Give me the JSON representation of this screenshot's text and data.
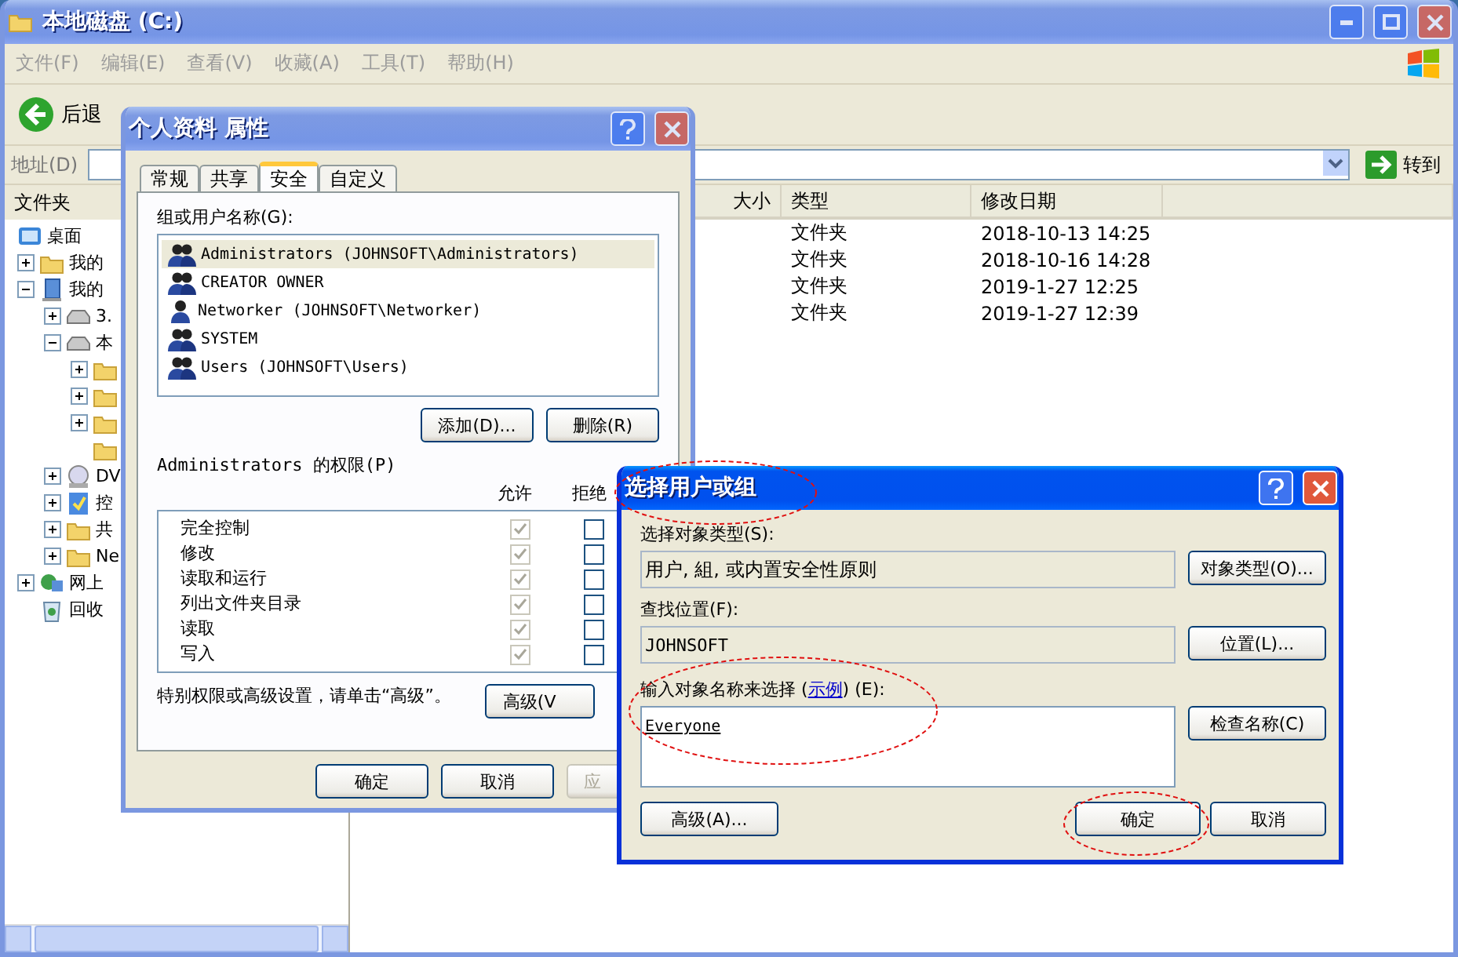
{
  "explorer": {
    "title": "本地磁盘 (C:)",
    "active": false,
    "menu": [
      "文件(F)",
      "编辑(E)",
      "查看(V)",
      "收藏(A)",
      "工具(T)",
      "帮助(H)"
    ],
    "back_label": "后退",
    "address_label": "地址(D)",
    "go_label": "转到",
    "folders_header": "文件夹",
    "tree": [
      {
        "label": "桌面",
        "kind": "desktop",
        "children": [
          {
            "label": "我的",
            "kind": "folder",
            "expanded": false
          },
          {
            "label": "我的",
            "kind": "computer",
            "expanded": true,
            "children": [
              {
                "label": "3.",
                "kind": "drive",
                "expanded": false
              },
              {
                "label": "本",
                "kind": "drive",
                "expanded": true,
                "children": [
                  {
                    "kind": "folder",
                    "expanded": false
                  },
                  {
                    "kind": "folder",
                    "expanded": false
                  },
                  {
                    "kind": "folder",
                    "expanded": false
                  },
                  {
                    "kind": "folder"
                  }
                ]
              },
              {
                "label": "DV",
                "kind": "disc",
                "expanded": false
              },
              {
                "label": "控",
                "kind": "panel",
                "expanded": false
              },
              {
                "label": "共",
                "kind": "folder",
                "expanded": false
              },
              {
                "label": "Ne",
                "kind": "folder",
                "expanded": false
              }
            ]
          },
          {
            "label": "网上",
            "kind": "network",
            "expanded": false
          },
          {
            "label": "回收",
            "kind": "bin"
          }
        ]
      }
    ],
    "columns": [
      "大小",
      "类型",
      "修改日期"
    ],
    "rows": [
      {
        "type": "文件夹",
        "modified": "2018-10-13 14:25"
      },
      {
        "type": "文件夹",
        "modified": "2018-10-16 14:28"
      },
      {
        "type": "文件夹",
        "modified": "2019-1-27 12:25"
      },
      {
        "type": "文件夹",
        "modified": "2019-1-27 12:39"
      }
    ]
  },
  "properties_dialog": {
    "title": "个人资料 属性",
    "active": false,
    "tabs": [
      {
        "label": "常规",
        "selected": false
      },
      {
        "label": "共享",
        "selected": false
      },
      {
        "label": "安全",
        "selected": true
      },
      {
        "label": "自定义",
        "selected": false
      }
    ],
    "users_label": "组或用户名称(G):",
    "users": [
      {
        "name": "Administrators (JOHNSOFT\\Administrators)",
        "kind": "group",
        "selected": true
      },
      {
        "name": "CREATOR OWNER",
        "kind": "group",
        "selected": false
      },
      {
        "name": "Networker (JOHNSOFT\\Networker)",
        "kind": "user",
        "selected": false
      },
      {
        "name": "SYSTEM",
        "kind": "group",
        "selected": false
      },
      {
        "name": "Users (JOHNSOFT\\Users)",
        "kind": "group",
        "selected": false
      }
    ],
    "user_buttons": [
      "添加(D)...",
      "删除(R)"
    ],
    "permissions_label": "Administrators 的权限(P)",
    "allow_header": "允许",
    "deny_header": "拒绝",
    "permissions": [
      {
        "name": "完全控制",
        "allow": true,
        "deny": false,
        "inherited": true
      },
      {
        "name": "修改",
        "allow": true,
        "deny": false,
        "inherited": true
      },
      {
        "name": "读取和运行",
        "allow": true,
        "deny": false,
        "inherited": true
      },
      {
        "name": "列出文件夹目录",
        "allow": true,
        "deny": false,
        "inherited": true
      },
      {
        "name": "读取",
        "allow": true,
        "deny": false,
        "inherited": true
      },
      {
        "name": "写入",
        "allow": true,
        "deny": false,
        "inherited": true
      }
    ],
    "note": "特别权限或高级设置，请单击“高级”。",
    "advanced_button": {
      "label": "高级(V",
      "cut": true
    },
    "buttons": [
      {
        "label": "确定",
        "disabled": false,
        "cut": false
      },
      {
        "label": "取消",
        "disabled": false,
        "cut": false
      },
      {
        "label": "应",
        "disabled": true,
        "cut": true
      }
    ]
  },
  "select_dialog": {
    "title": "选择用户或组",
    "active": true,
    "type_label": "选择对象类型(S):",
    "type_value": "用户, 組, 或内置安全性原则",
    "type_button": "对象类型(O)...",
    "location_label": "查找位置(F):",
    "location_value": "JOHNSOFT",
    "location_button": "位置(L)...",
    "names_label_before": "输入对象名称来选择 (",
    "names_link": "示例",
    "names_label_after": ") (E):",
    "names_value": "Everyone",
    "check_button": "检查名称(C)",
    "advanced_button": "高级(A)...",
    "ok_button": "确定",
    "cancel_button": "取消"
  }
}
